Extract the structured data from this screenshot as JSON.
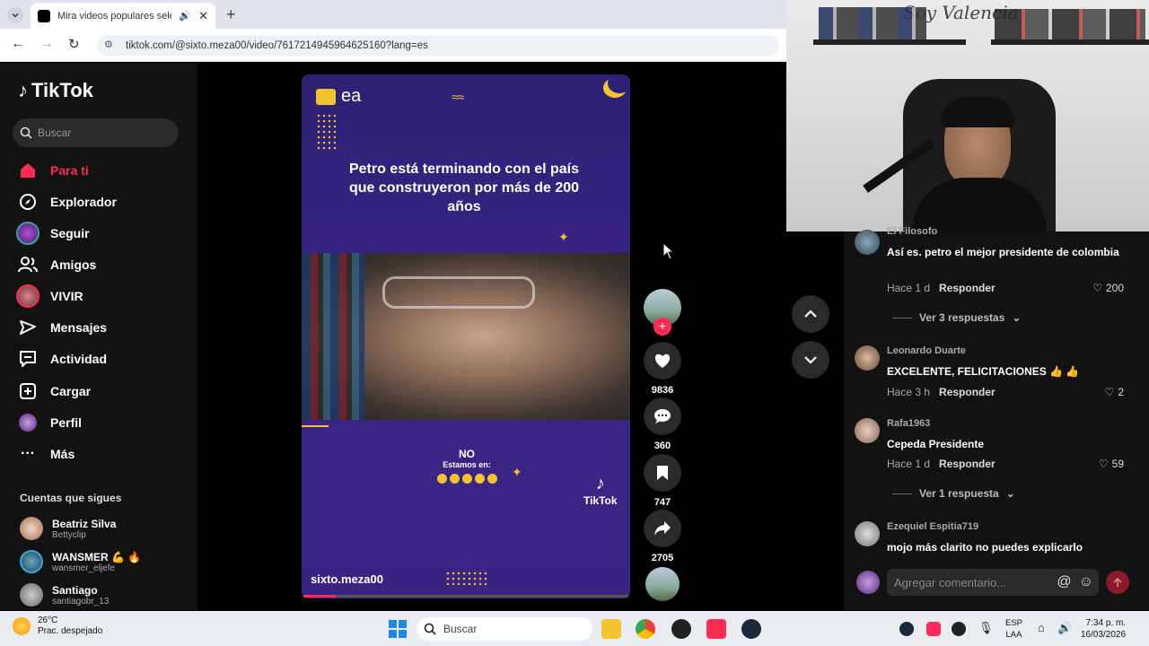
{
  "browser": {
    "tab_title": "Mira videos populares selec",
    "url": "tiktok.com/@sixto.meza00/video/7617214945964625160?lang=es"
  },
  "sidebar": {
    "logo": "TikTok",
    "search_placeholder": "Buscar",
    "nav": [
      {
        "label": "Para ti",
        "icon": "home-icon"
      },
      {
        "label": "Explorador",
        "icon": "compass-icon"
      },
      {
        "label": "Seguir",
        "icon": "following-avatar"
      },
      {
        "label": "Amigos",
        "icon": "friends-icon"
      },
      {
        "label": "VIVIR",
        "icon": "live-avatar"
      },
      {
        "label": "Mensajes",
        "icon": "messages-icon"
      },
      {
        "label": "Actividad",
        "icon": "activity-icon"
      },
      {
        "label": "Cargar",
        "icon": "upload-icon"
      },
      {
        "label": "Perfil",
        "icon": "profile-avatar"
      },
      {
        "label": "Más",
        "icon": "more-icon"
      }
    ],
    "following_header": "Cuentas que sigues",
    "following": [
      {
        "name": "Beatriz Silva",
        "user": "Bettyclip"
      },
      {
        "name": "WANSMER 💪 🔥",
        "user": "wansmer_eljefe"
      },
      {
        "name": "Santiago",
        "user": "santiagobr_13"
      }
    ]
  },
  "video": {
    "brand": "ea",
    "headline": "Petro está terminando con el país que construyeron por más de 200 años",
    "no_label": "NO",
    "estamos": "Estamos en:",
    "tiktok_mark": "TikTok",
    "author": "sixto.meza00",
    "progress": 0.1
  },
  "actions": {
    "likes": "9836",
    "comments": "360",
    "saves": "747",
    "shares": "2705"
  },
  "comments": [
    {
      "user": "El Filosofo",
      "text": "Así es. petro el mejor presidente de colombia",
      "time": "Hace 1 d",
      "reply": "Responder",
      "likes": "200"
    },
    {
      "user": "Leonardo Duarte",
      "text": "EXCELENTE, FELICITACIONES 👍 👍",
      "time": "Hace 3 h",
      "reply": "Responder",
      "likes": "2"
    },
    {
      "user": "Rafa1963",
      "text": "Cepeda Presidente",
      "time": "Hace 1 d",
      "reply": "Responder",
      "likes": "59"
    },
    {
      "user": "Ezequiel Espitia719",
      "text": "mojo más clarito no puedes explicarlo"
    }
  ],
  "replies": [
    "Ver 3 respuestas",
    "Ver 1 respuesta"
  ],
  "comment_input_placeholder": "Agregar comentario...",
  "webcam_sign": "Soy Valencia",
  "taskbar": {
    "temp": "26°C",
    "weather": "Prac. despejado",
    "search": "Buscar",
    "lang1": "ESP",
    "lang2": "LAA",
    "time": "7:34 p. m.",
    "date": "16/03/2026"
  },
  "colors": {
    "accent": "#fe2c55",
    "video_bg": "#3a2686"
  }
}
